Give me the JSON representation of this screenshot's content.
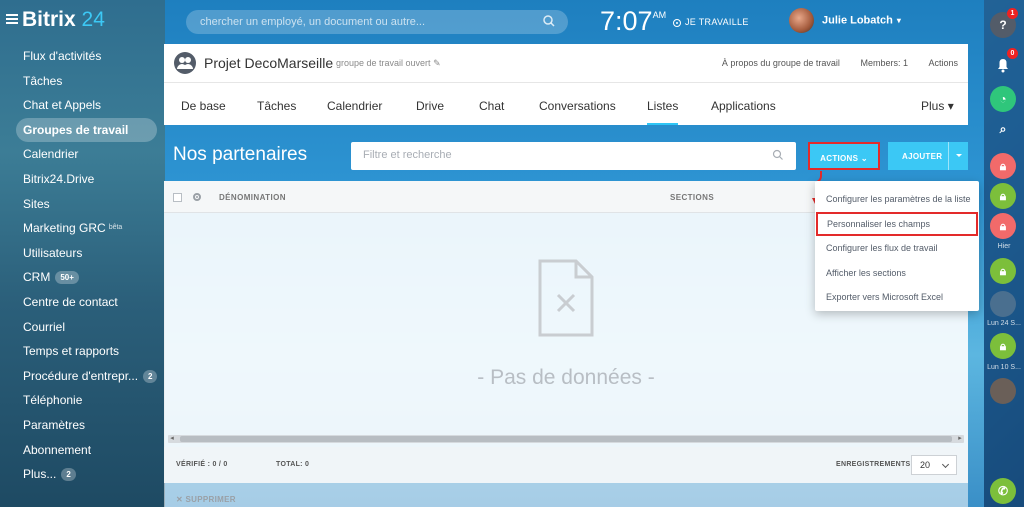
{
  "header": {
    "logo_text": "Bitrix",
    "logo_num": "24",
    "search_placeholder": "chercher un employé, un document ou autre...",
    "clock_time": "7:07",
    "clock_ampm": "AM",
    "work_status": "JE TRAVAILLE",
    "user_name": "Julie Lobatch"
  },
  "sidebar": {
    "items": [
      {
        "label": "Flux d'activités"
      },
      {
        "label": "Tâches"
      },
      {
        "label": "Chat et Appels"
      },
      {
        "label": "Groupes de travail",
        "active": true
      },
      {
        "label": "Calendrier"
      },
      {
        "label": "Bitrix24.Drive"
      },
      {
        "label": "Sites"
      },
      {
        "label": "Marketing GRC",
        "badge_small": "bêta"
      },
      {
        "label": "Utilisateurs"
      },
      {
        "label": "CRM",
        "badge": "50+"
      },
      {
        "label": "Centre de contact"
      },
      {
        "label": "Courriel"
      },
      {
        "label": "Temps et rapports"
      },
      {
        "label": "Procédure d'entrepr...",
        "badge": "2"
      },
      {
        "label": "Téléphonie"
      },
      {
        "label": "Paramètres"
      },
      {
        "label": "Abonnement"
      },
      {
        "label": "Plus...",
        "badge": "2"
      }
    ]
  },
  "group": {
    "title": "Projet DecoMarseille",
    "type": "groupe de travail ouvert",
    "about": "À propos du groupe de travail",
    "members": "Members: 1",
    "actions": "Actions"
  },
  "tabs": [
    {
      "label": "De base"
    },
    {
      "label": "Tâches"
    },
    {
      "label": "Calendrier"
    },
    {
      "label": "Drive"
    },
    {
      "label": "Chat"
    },
    {
      "label": "Conversations"
    },
    {
      "label": "Listes",
      "active": true
    },
    {
      "label": "Applications"
    },
    {
      "label": "Plus"
    }
  ],
  "toolbar": {
    "title": "Nos partenaires",
    "filter_placeholder": "Filtre et recherche",
    "actions_label": "ACTIONS",
    "add_label": "AJOUTER"
  },
  "grid": {
    "col_name": "DÉNOMINATION",
    "col_sections": "SECTIONS",
    "empty_text": "- Pas de données -",
    "verified": "VÉRIFIÉ : 0 / 0",
    "total": "TOTAL: 0",
    "records_label": "ENREGISTREMENTS :",
    "page_size": "20",
    "delete_label": "SUPPRIMER"
  },
  "menu": {
    "items": [
      {
        "label": "Configurer les paramètres de la liste"
      },
      {
        "label": "Personnaliser les champs",
        "highlighted": true
      },
      {
        "label": "Configurer les flux de travail"
      },
      {
        "label": "Afficher les sections"
      },
      {
        "label": "Exporter vers Microsoft Excel"
      }
    ]
  },
  "rightbar": {
    "help": "?",
    "help_count": "1",
    "bell_count": "0",
    "label_hier": "Hier",
    "label_lun1": "Lun 24 S...",
    "label_lun2": "Lun 10 S..."
  },
  "colors": {
    "accent": "#3bc8f5",
    "highlight_border": "#e32a2a",
    "online_green": "#7cbf3b",
    "locked_red": "#f26a6a"
  }
}
